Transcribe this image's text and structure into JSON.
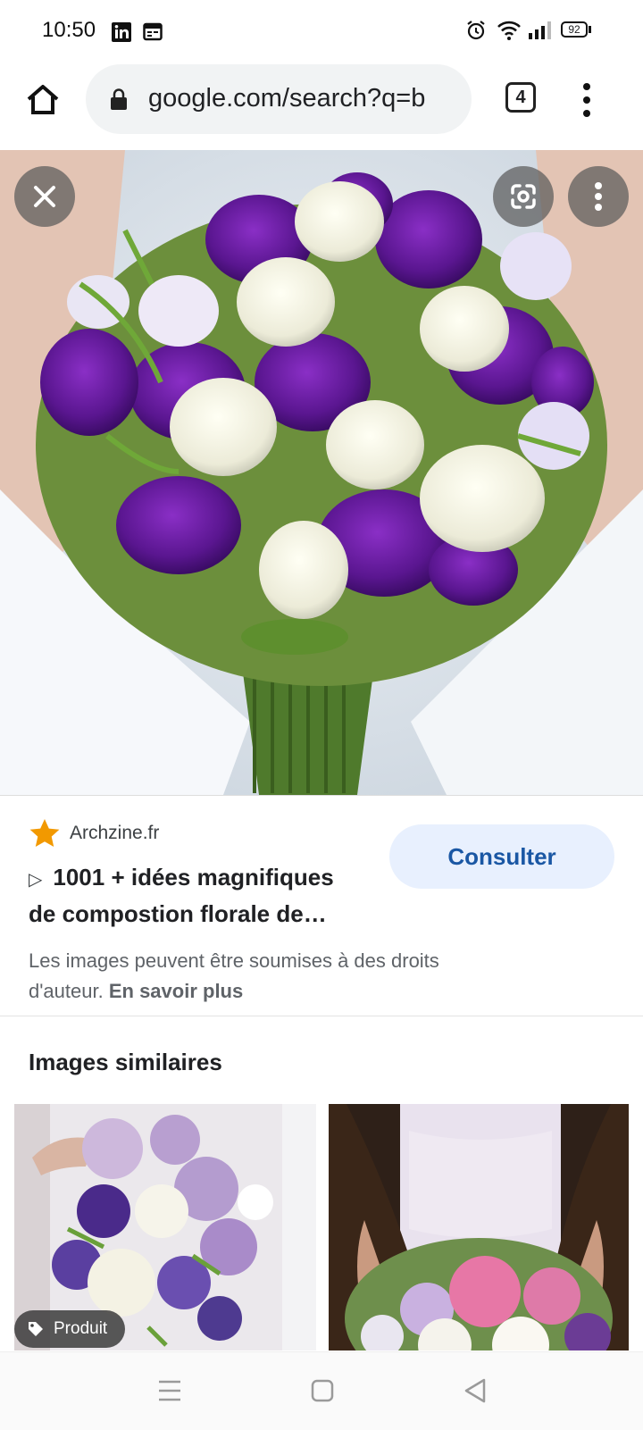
{
  "status_bar": {
    "time": "10:50",
    "battery": "92",
    "icons": [
      "linkedin-icon",
      "calendar-icon",
      "alarm-icon",
      "wifi-icon",
      "signal-icon",
      "battery-icon"
    ]
  },
  "browser": {
    "url": "google.com/search?q=b",
    "tab_count": "4",
    "icons": [
      "home-icon",
      "lock-icon",
      "tabs-icon",
      "menu-icon"
    ]
  },
  "viewer": {
    "icons": [
      "close-icon",
      "lens-icon",
      "more-icon"
    ]
  },
  "result": {
    "source": "Archzine.fr",
    "title_line1": "1001 + idées magnifiques",
    "title_line2": "de compostion florale de…",
    "action_label": "Consulter",
    "rights_line1": "Les images peuvent être soumises à des droits",
    "rights_line2_prefix": "d'auteur.",
    "rights_link": "En savoir plus"
  },
  "similar": {
    "heading": "Images similaires",
    "badge": "Produit"
  },
  "colors": {
    "accent": "#1a57a4",
    "button_bg": "#e8f0fe",
    "star": "#f29900",
    "purple": "#5b1a9a"
  }
}
